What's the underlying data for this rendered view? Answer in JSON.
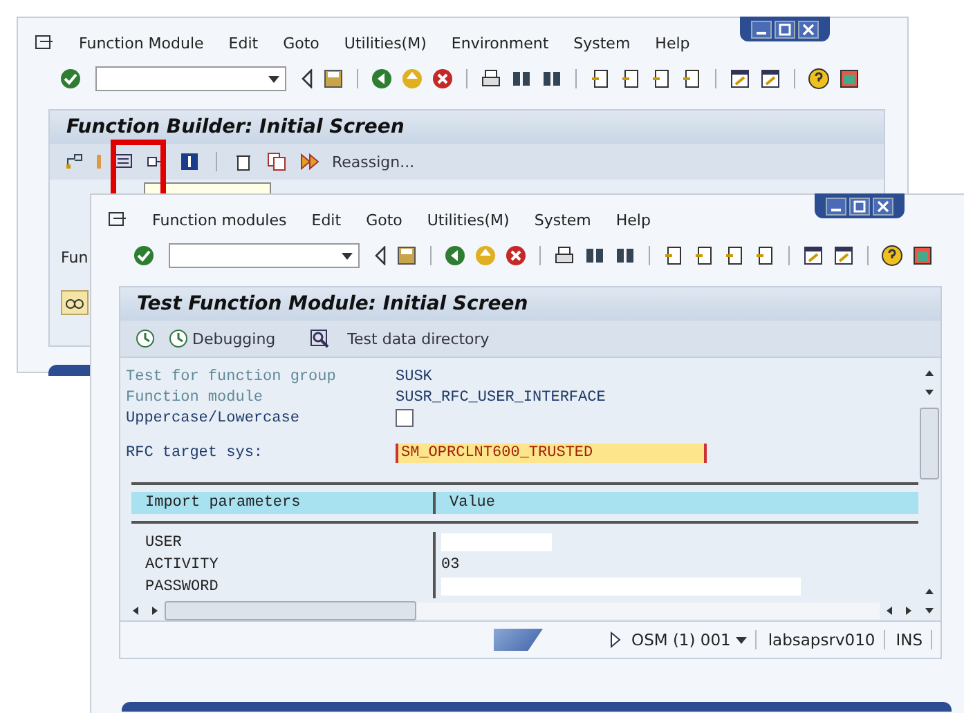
{
  "back_window": {
    "menu": [
      "Function Module",
      "Edit",
      "Goto",
      "Utilities(M)",
      "Environment",
      "System",
      "Help"
    ],
    "title": "Function Builder: Initial Screen",
    "app_toolbar": {
      "button": "Reassign..."
    },
    "field_label": "Fun"
  },
  "front_window": {
    "menu": [
      "Function modules",
      "Edit",
      "Goto",
      "Utilities(M)",
      "System",
      "Help"
    ],
    "title": "Test Function Module: Initial Screen",
    "app_toolbar": [
      "Debugging",
      "Test data directory"
    ],
    "fields": [
      {
        "kind": "text",
        "label": "Test for function group",
        "value": "SUSK"
      },
      {
        "kind": "text",
        "label": "Function module",
        "value": "SUSR_RFC_USER_INTERFACE"
      },
      {
        "kind": "checkbox",
        "label": "Uppercase/Lowercase",
        "checked": false
      },
      {
        "kind": "input",
        "label": "RFC target sys:",
        "value": "SM_OPRCLNT600_TRUSTED"
      }
    ],
    "table": {
      "columns": [
        "Import parameters",
        "Value"
      ],
      "rows": [
        {
          "name": "USER"
        },
        {
          "name": "ACTIVITY",
          "value": "03"
        },
        {
          "name": "PASSWORD"
        }
      ]
    },
    "status_bar": {
      "system": "OSM (1) 001",
      "server": "labsapsrv010",
      "mode": "INS"
    }
  }
}
